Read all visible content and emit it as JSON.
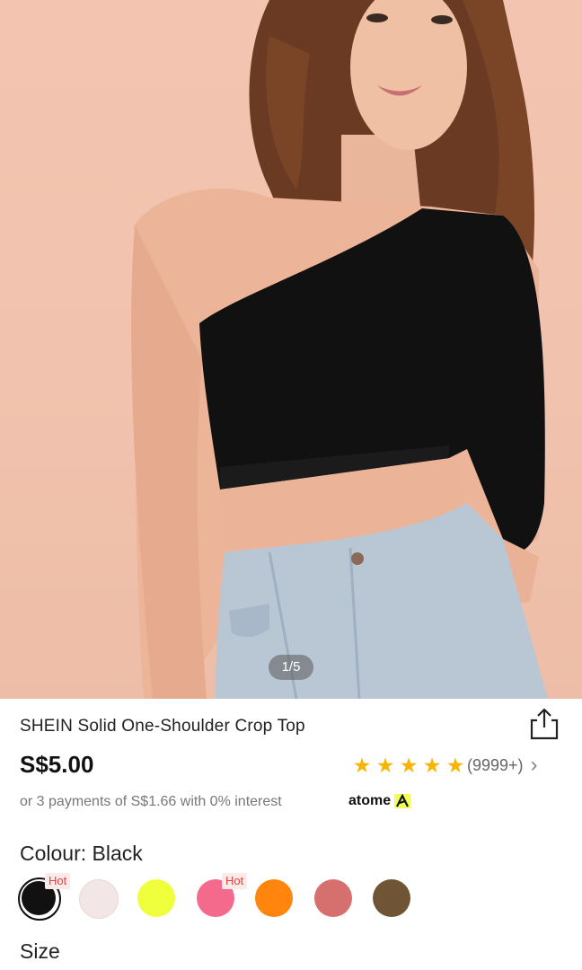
{
  "gallery": {
    "counter": "1/5"
  },
  "product": {
    "title": "SHEIN Solid One-Shoulder Crop Top",
    "price": "S$5.00",
    "rating": {
      "stars": 5,
      "star_glyph": "★",
      "count": "(9999+)",
      "chevron": "›"
    },
    "installment_text": "or 3 payments of S$1.66 with 0% interest",
    "installment_brand": "atome",
    "colour_label": "Colour: Black",
    "size_label": "Size"
  },
  "swatches": [
    {
      "name": "Black",
      "color": "#111111",
      "selected": true,
      "badge": "Hot"
    },
    {
      "name": "Light Pink",
      "color": "#f3e6e6",
      "selected": false,
      "badge": ""
    },
    {
      "name": "Neon Yellow",
      "color": "#f0ff3c",
      "selected": false,
      "badge": ""
    },
    {
      "name": "Pink",
      "color": "#f46a8c",
      "selected": false,
      "badge": "Hot"
    },
    {
      "name": "Orange",
      "color": "#ff850f",
      "selected": false,
      "badge": ""
    },
    {
      "name": "Dusty Pink",
      "color": "#d6706f",
      "selected": false,
      "badge": ""
    },
    {
      "name": "Brown",
      "color": "#6f5435",
      "selected": false,
      "badge": ""
    }
  ],
  "colors": {
    "star": "#f8b400",
    "hot_text": "#e8413d",
    "hot_bg": "#fbeaea",
    "atome_accent": "#f0ff5a"
  }
}
